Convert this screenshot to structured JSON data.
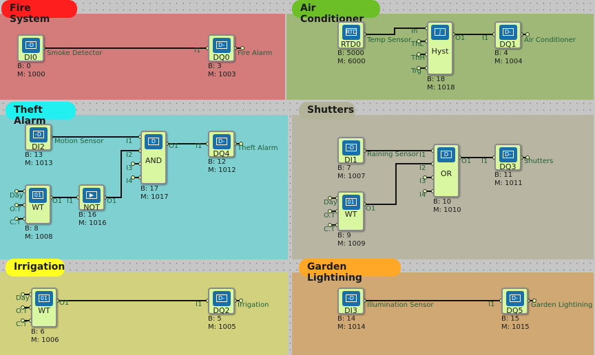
{
  "groups": [
    {
      "title": "Fire System",
      "color": "#d47c7c",
      "label_color": "#ff1e1e"
    },
    {
      "title": "Air Conditioner",
      "color": "#9fb878",
      "label_color": "#6cbf26"
    },
    {
      "title": "Theft Alarm",
      "color": "#7fd0d0",
      "label_color": "#22f0f0"
    },
    {
      "title": "Shutters",
      "color": "#b8b5a2",
      "label_color": "#b3b39a"
    },
    {
      "title": "Irrigation",
      "color": "#d2d27e",
      "label_color": "#ffff22"
    },
    {
      "title": "Garden Lightining",
      "color": "#d0a874",
      "label_color": "#ffa726"
    }
  ],
  "blocks": {
    "di0": {
      "name": "DI0",
      "b": "B: 0",
      "m": "M: 1000",
      "signal": "Smoke Detector",
      "icon": "digital-input-icon"
    },
    "dq0": {
      "name": "DQ0",
      "b": "B: 3",
      "m": "M: 1003",
      "signal": "Fire Alarm",
      "icon": "digital-output-icon"
    },
    "rtd0": {
      "name": "RTD0",
      "b": "B: 5000",
      "m": "M: 6000",
      "signal": "Temp Sensor",
      "icon": "rtd-icon"
    },
    "hyst": {
      "name": "Hyst",
      "b": "B: 18",
      "m": "M: 1018",
      "icon": "hysteresis-icon"
    },
    "dq1": {
      "name": "DQ1",
      "b": "B: 4",
      "m": "M: 1004",
      "signal": "Air Conditioner",
      "icon": "digital-output-icon"
    },
    "di2": {
      "name": "DI2",
      "b": "B: 13",
      "m": "M: 1013",
      "signal": "Motion Sensor",
      "icon": "digital-input-icon"
    },
    "and": {
      "name": "AND",
      "b": "B: 17",
      "m": "M: 1017",
      "icon": "and-gate-icon"
    },
    "dq4": {
      "name": "DQ4",
      "b": "B: 12",
      "m": "M: 1012",
      "signal": "Theft Alarm",
      "icon": "digital-output-icon"
    },
    "wt8": {
      "name": "WT",
      "b": "B: 8",
      "m": "M: 1008",
      "icon": "weekly-timer-icon"
    },
    "not": {
      "name": "NOT",
      "b": "B: 16",
      "m": "M: 1016",
      "icon": "not-gate-icon"
    },
    "di1": {
      "name": "DI1",
      "b": "B: 7",
      "m": "M: 1007",
      "signal": "Raining Sensor",
      "icon": "digital-input-icon"
    },
    "or": {
      "name": "OR",
      "b": "B: 10",
      "m": "M: 1010",
      "icon": "or-gate-icon"
    },
    "dq3": {
      "name": "DQ3",
      "b": "B: 11",
      "m": "M: 1011",
      "signal": "Shutters",
      "icon": "digital-output-icon"
    },
    "wt9": {
      "name": "WT",
      "b": "B: 9",
      "m": "M: 1009",
      "icon": "weekly-timer-icon"
    },
    "wt6": {
      "name": "WT",
      "b": "B: 6",
      "m": "M: 1006",
      "icon": "weekly-timer-icon"
    },
    "dq2": {
      "name": "DQ2",
      "b": "B: 5",
      "m": "M: 1005",
      "signal": "Irrigation",
      "icon": "digital-output-icon"
    },
    "di3": {
      "name": "DI3",
      "b": "B: 14",
      "m": "M: 1014",
      "signal": "Illumination Sensor",
      "icon": "digital-input-icon"
    },
    "dq5": {
      "name": "DQ5",
      "b": "B: 15",
      "m": "M: 1015",
      "signal": "Garden Lightining",
      "icon": "digital-output-icon"
    }
  },
  "pins": {
    "i1": "I1",
    "i2": "I2",
    "i3": "I3",
    "i4": "I4",
    "o1": "O1",
    "in": "In",
    "thl": "ThL",
    "thh": "ThH",
    "trg": "Trg",
    "day": "Day",
    "ot": "O.T",
    "ct": "C.T"
  },
  "icon_glyphs": {
    "digital-input-icon": "-D",
    "digital-output-icon": "D-",
    "rtd-icon": "RTD",
    "hysteresis-icon": "∫",
    "and-gate-icon": "D",
    "or-gate-icon": "D",
    "not-gate-icon": "▶",
    "weekly-timer-icon": "01"
  },
  "wire_color": "#111111"
}
